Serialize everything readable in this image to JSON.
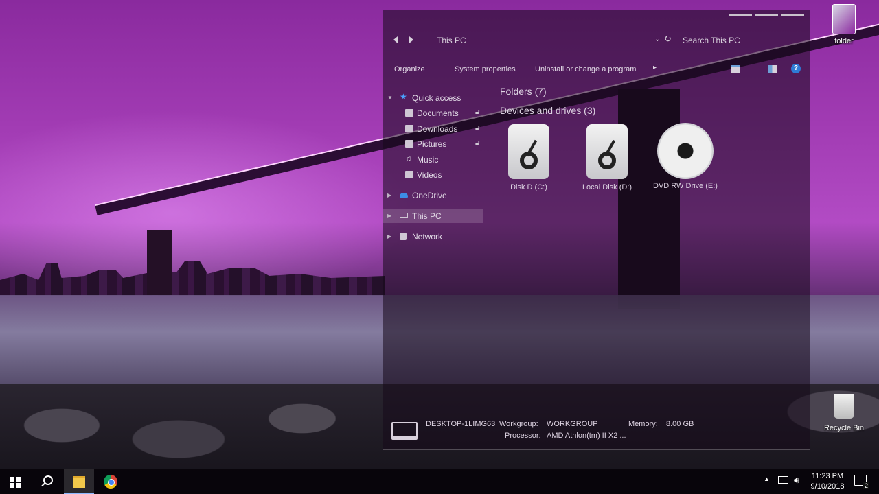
{
  "desktop": {
    "icons": [
      {
        "label": "folder"
      },
      {
        "label": "Recycle Bin"
      }
    ]
  },
  "explorer": {
    "address": "This PC",
    "search_placeholder": "Search This PC",
    "commands": {
      "organize": "Organize",
      "system_properties": "System properties",
      "uninstall": "Uninstall or change a program",
      "more": "▸"
    },
    "help": "?",
    "nav": {
      "quick_access": "Quick access",
      "documents": "Documents",
      "downloads": "Downloads",
      "pictures": "Pictures",
      "music": "Music",
      "videos": "Videos",
      "onedrive": "OneDrive",
      "this_pc": "This PC",
      "network": "Network"
    },
    "groups": {
      "folders": "Folders (7)",
      "devices": "Devices and drives (3)"
    },
    "drives": [
      {
        "label": "Disk D (C:)",
        "type": "hard-disk"
      },
      {
        "label": "Local Disk (D:)",
        "type": "hard-disk"
      },
      {
        "label": "DVD RW Drive (E:)",
        "type": "optical"
      }
    ],
    "details": {
      "computer_name": "DESKTOP-1LIMG63",
      "workgroup_label": "Workgroup:",
      "workgroup_value": "WORKGROUP",
      "memory_label": "Memory:",
      "memory_value": "8.00 GB",
      "processor_label": "Processor:",
      "processor_value": "AMD Athlon(tm) II X2 ..."
    }
  },
  "taskbar": {
    "time": "11:23 PM",
    "date": "9/10/2018",
    "notification_count": "2"
  },
  "colors": {
    "accent": "#2e7bd6",
    "wallpaper_purple": "#a13bb3"
  }
}
